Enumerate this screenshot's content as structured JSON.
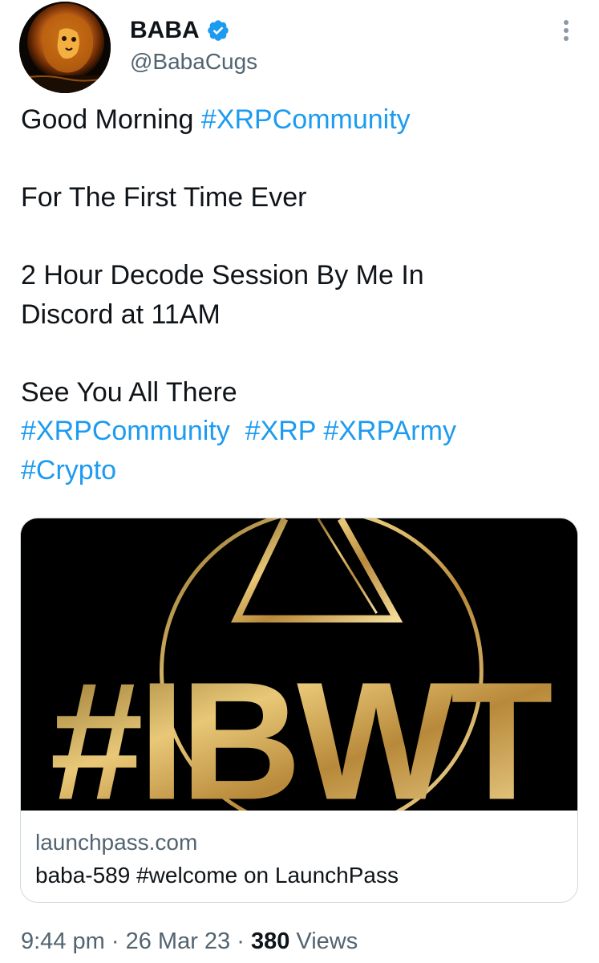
{
  "author": {
    "display_name": "BABA",
    "handle": "@BabaCugs",
    "verified": true,
    "avatar_icon": "lion-avatar"
  },
  "tweet": {
    "line1_text": "Good Morning ",
    "line1_hashtag": "#XRPCommunity",
    "line2_text": "For The First Time Ever",
    "line3_text": "2 Hour Decode Session By Me In",
    "line4_text": "Discord at 11AM",
    "line5_text": "See You All There",
    "hashtags_line": [
      "#XRPCommunity",
      "#XRP",
      "#XRPArmy"
    ],
    "last_hashtag": "#Crypto"
  },
  "card": {
    "image_logo_text": "#IBWT",
    "domain": "launchpass.com",
    "title": "baba-589 #welcome on LaunchPass"
  },
  "meta": {
    "time": "9:44 pm",
    "separator": "·",
    "date": "26 Mar 23",
    "views_count": "380",
    "views_label": "Views"
  },
  "colors": {
    "link": "#1d9bf0",
    "text": "#0f1419",
    "secondary": "#536471",
    "border": "#cfd9de",
    "gold": "#d4a94a"
  }
}
